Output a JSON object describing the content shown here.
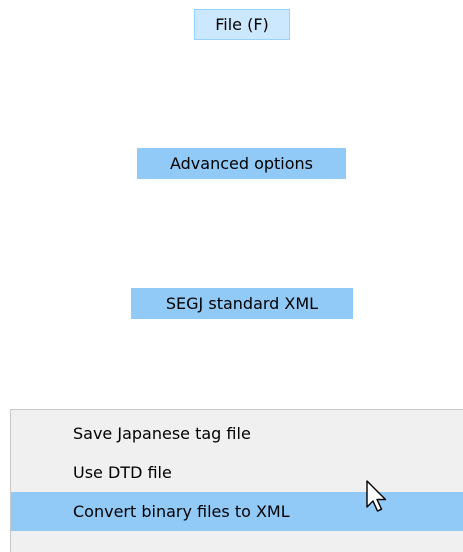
{
  "steps": {
    "file_menu": "File (F)",
    "advanced_options": "Advanced options",
    "segj_standard_xml": "SEGJ standard XML"
  },
  "submenu": {
    "items": [
      {
        "label": "Save Japanese tag file",
        "highlighted": false
      },
      {
        "label": "Use DTD file",
        "highlighted": false
      },
      {
        "label": "Convert binary files to XML",
        "highlighted": true
      }
    ]
  },
  "colors": {
    "highlight": "#91c9f7",
    "file_menu_bg": "#cce8ff",
    "menu_bg": "#f0f0f0"
  },
  "cursor": {
    "icon": "mouse-pointer-icon"
  }
}
